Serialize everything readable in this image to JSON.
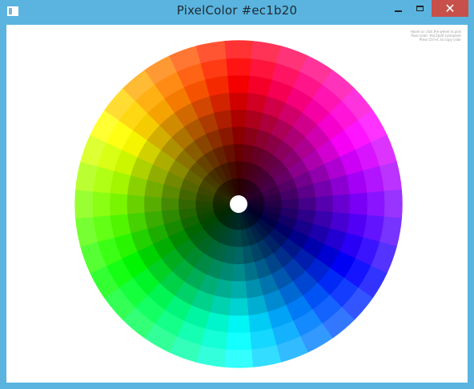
{
  "window": {
    "title": "PixelColor #ec1b20",
    "controls": {
      "minimize_icon": "minimize-icon",
      "maximize_icon": "maximize-icon",
      "close_icon": "close-icon",
      "close_glyph": "✕"
    }
  },
  "info_lines": [
    "Hover or click the wheel to pick",
    "Pixel color: #ec1b20 (sampled)",
    "Press Ctrl+C to copy color"
  ],
  "wheel": {
    "selected_color": "#ec1b20",
    "hue_segments": 36,
    "rings": 9,
    "center_color": "#ffffff",
    "ring_lightness": [
      0.08,
      0.14,
      0.2,
      0.27,
      0.34,
      0.41,
      0.48,
      0.54,
      0.6
    ]
  },
  "colors": {
    "titlebar": "#5ab4df",
    "close_button": "#c7504b",
    "client_background": "#ffffff"
  }
}
